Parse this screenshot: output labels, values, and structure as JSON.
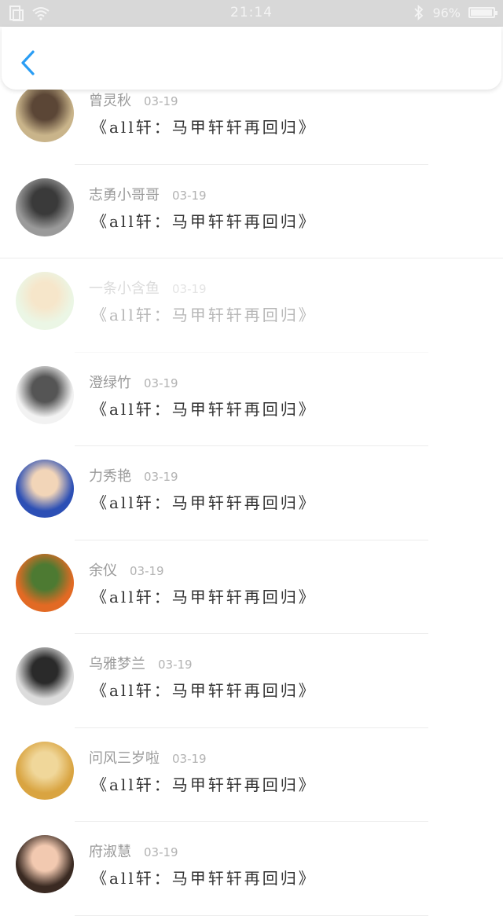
{
  "status_bar": {
    "time": "21:14",
    "battery": "96%",
    "battery_level": 0.96,
    "icons": [
      "sim-icon",
      "wifi-icon",
      "bluetooth-icon",
      "battery-icon"
    ]
  },
  "header": {
    "back_icon": "chevron-left-icon",
    "accent_color": "#2a9df4"
  },
  "messages": [
    {
      "name": "曾灵秋",
      "date": "03-19",
      "message": "《all轩：马甲轩轩再回归》",
      "avatar_colors": [
        "#c9b48a",
        "#5b4636"
      ]
    },
    {
      "name": "志勇小哥哥",
      "date": "03-19",
      "message": "《all轩：马甲轩轩再回归》",
      "avatar_colors": [
        "#9a9a9a",
        "#3a3a3a"
      ]
    },
    {
      "name": "一条小含鱼",
      "date": "03-19",
      "message": "《all轩：马甲轩轩再回归》",
      "avatar_colors": [
        "#c7e7b6",
        "#e8b96a"
      ]
    },
    {
      "name": "澄绿竹",
      "date": "03-19",
      "message": "《all轩：马甲轩轩再回归》",
      "avatar_colors": [
        "#f2f2f2",
        "#555555"
      ]
    },
    {
      "name": "力秀艳",
      "date": "03-19",
      "message": "《all轩：马甲轩轩再回归》",
      "avatar_colors": [
        "#2c4fb5",
        "#f2d5b8"
      ]
    },
    {
      "name": "余仪",
      "date": "03-19",
      "message": "《all轩：马甲轩轩再回归》",
      "avatar_colors": [
        "#e26a24",
        "#4d7a32"
      ]
    },
    {
      "name": "乌雅梦兰",
      "date": "03-19",
      "message": "《all轩：马甲轩轩再回归》",
      "avatar_colors": [
        "#dcdcdc",
        "#2a2a2a"
      ]
    },
    {
      "name": "问风三岁啦",
      "date": "03-19",
      "message": "《all轩：马甲轩轩再回归》",
      "avatar_colors": [
        "#d9a441",
        "#f0d79a"
      ]
    },
    {
      "name": "府淑慧",
      "date": "03-19",
      "message": "《all轩：马甲轩轩再回归》",
      "avatar_colors": [
        "#3a2a22",
        "#f2c9b0"
      ]
    }
  ]
}
